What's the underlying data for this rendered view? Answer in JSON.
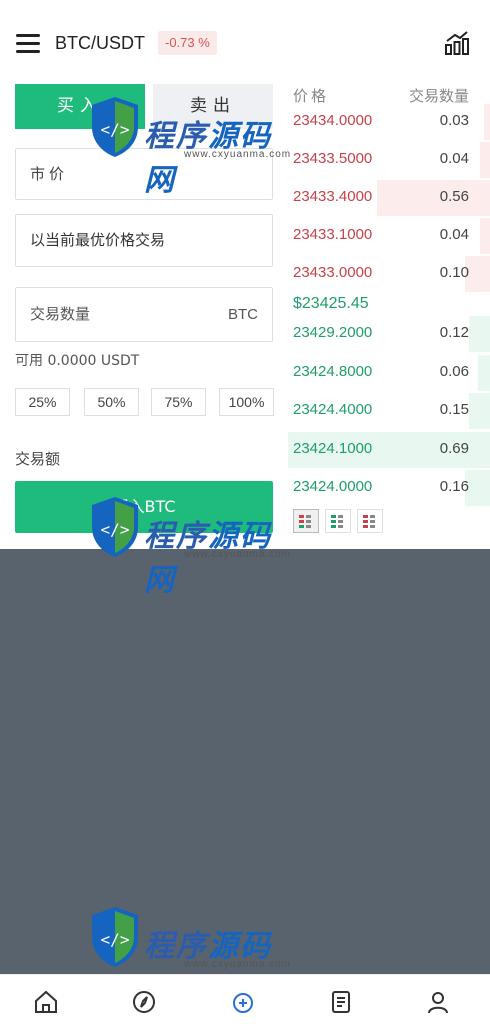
{
  "header": {
    "pair": "BTC/USDT",
    "change": "-0.73 %",
    "icons": [
      "menu-icon",
      "chart-icon"
    ]
  },
  "tabs": {
    "buy": "买入",
    "sell": "卖出"
  },
  "form": {
    "order_type": "市价",
    "price_mode": "以当前最优价格交易",
    "quantity_placeholder": "交易数量",
    "quantity_unit": "BTC",
    "available": "可用 0.0000 USDT",
    "percent_buttons": [
      "25%",
      "50%",
      "75%",
      "100%"
    ],
    "amount_label": "交易额",
    "submit": "买入BTC"
  },
  "orderbook": {
    "price_header": "价格",
    "qty_header": "交易数量",
    "asks": [
      {
        "price": "23434.0000",
        "qty": "0.03",
        "depth": 0.03
      },
      {
        "price": "23433.5000",
        "qty": "0.04",
        "depth": 0.05
      },
      {
        "price": "23433.4000",
        "qty": "0.56",
        "depth": 0.55
      },
      {
        "price": "23433.1000",
        "qty": "0.04",
        "depth": 0.05
      },
      {
        "price": "23433.0000",
        "qty": "0.10",
        "depth": 0.12
      }
    ],
    "last_price": "$23425.45",
    "bids": [
      {
        "price": "23429.2000",
        "qty": "0.12",
        "depth": 0.1
      },
      {
        "price": "23424.8000",
        "qty": "0.06",
        "depth": 0.06
      },
      {
        "price": "23424.4000",
        "qty": "0.15",
        "depth": 0.1
      },
      {
        "price": "23424.1000",
        "qty": "0.69",
        "depth": 0.98
      },
      {
        "price": "23424.0000",
        "qty": "0.16",
        "depth": 0.12
      }
    ],
    "colors": {
      "ask": "#c9414b",
      "bid": "#1e9f69",
      "buy": "#1fbb7c"
    }
  },
  "watermark": {
    "title_a": "程序",
    "title_b": "源码网",
    "url": "www.cxyuanma.com"
  },
  "tabbar": [
    "home-icon",
    "compass-icon",
    "trade-icon",
    "orders-icon",
    "profile-icon"
  ]
}
